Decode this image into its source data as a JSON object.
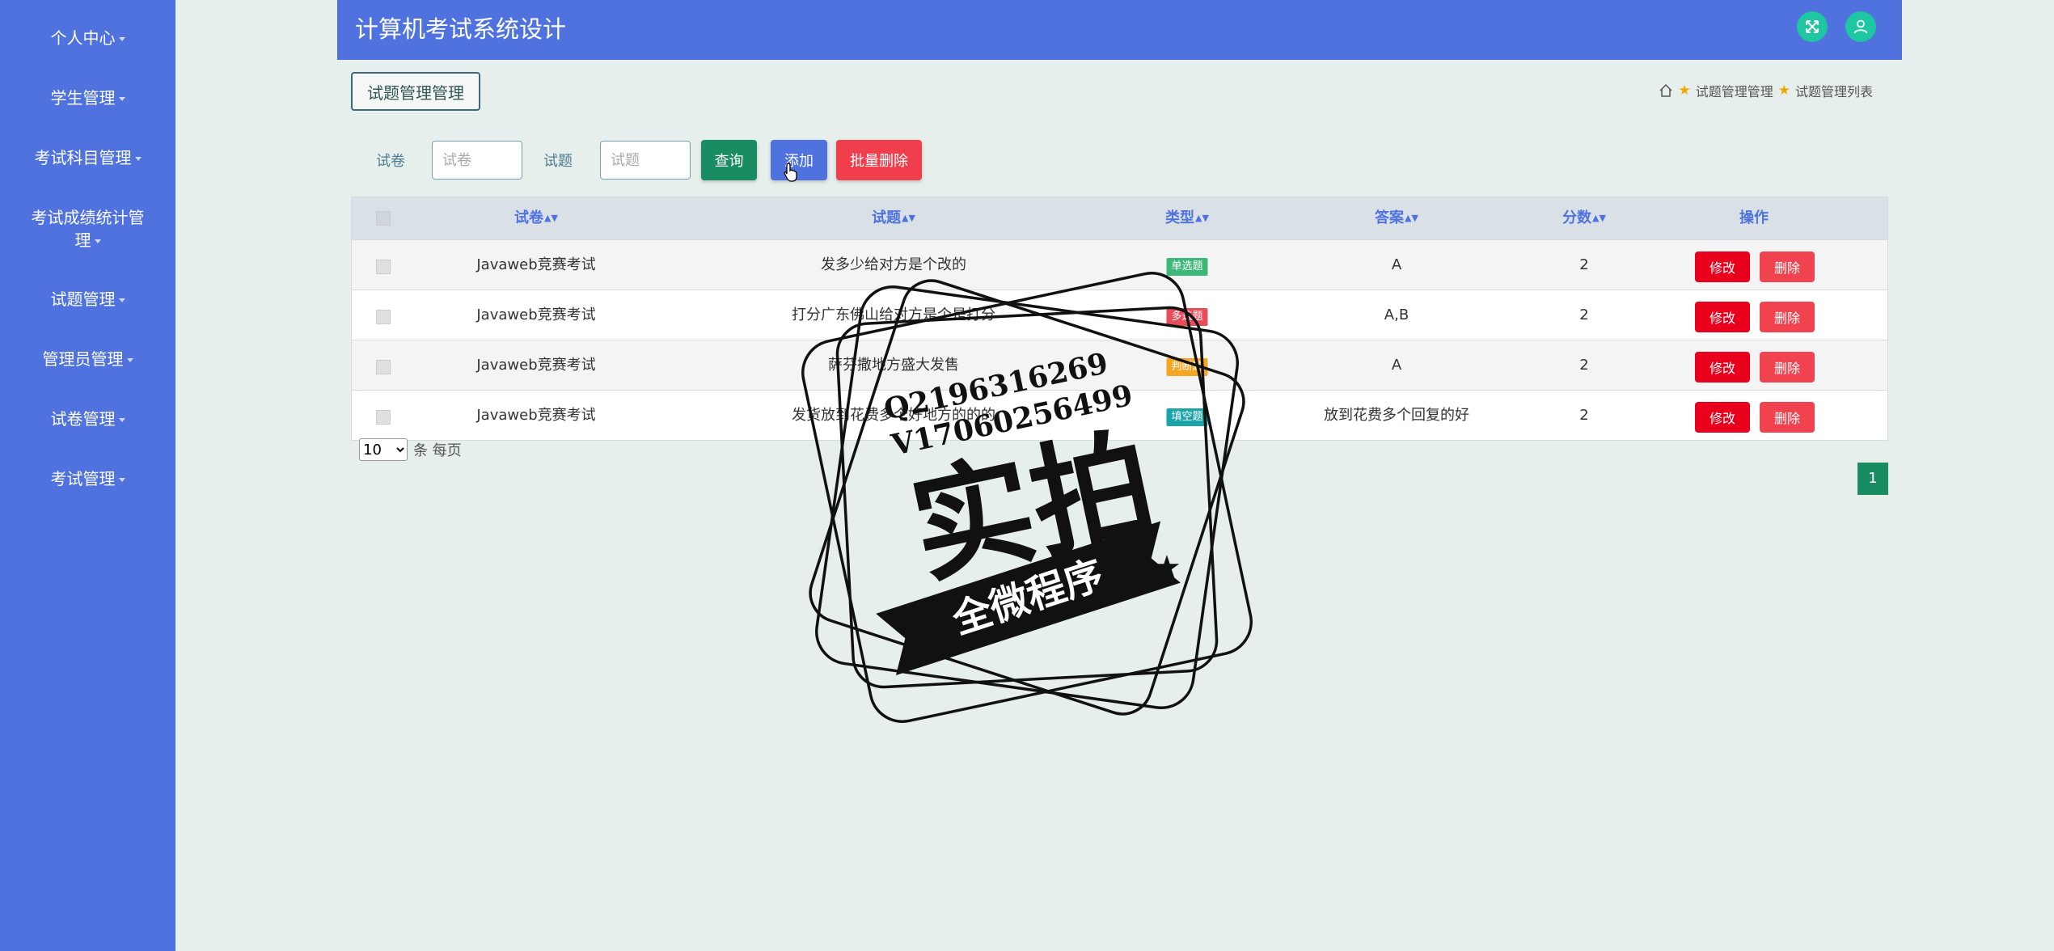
{
  "header": {
    "title": "计算机考试系统设计",
    "icons": [
      "expand-icon",
      "user-icon"
    ],
    "accent_color": "#4f72df"
  },
  "sidebar": {
    "items": [
      {
        "label": "个人中心"
      },
      {
        "label": "学生管理"
      },
      {
        "label": "考试科目管理"
      },
      {
        "label": "考试成绩统计管",
        "label2": "理"
      },
      {
        "label": "试题管理"
      },
      {
        "label": "管理员管理"
      },
      {
        "label": "试卷管理"
      },
      {
        "label": "考试管理"
      }
    ]
  },
  "panel": {
    "title": "试题管理管理",
    "breadcrumb": [
      "试题管理管理",
      "试题管理列表"
    ]
  },
  "search": {
    "paper_label": "试卷",
    "paper_placeholder": "试卷",
    "question_label": "试题",
    "question_placeholder": "试题",
    "query_button": "查询",
    "add_button": "添加",
    "batch_delete_button": "批量删除"
  },
  "table": {
    "headers": {
      "paper": "试卷",
      "question": "试题",
      "type": "类型",
      "answer": "答案",
      "score": "分数",
      "actions": "操作"
    },
    "edit_label": "修改",
    "delete_label": "删除",
    "rows": [
      {
        "paper": "Javaweb竞赛考试",
        "question": "发多少给对方是个改的",
        "type": "单选题",
        "type_color": "#3cb878",
        "answer": "A",
        "score": "2"
      },
      {
        "paper": "Javaweb竞赛考试",
        "question": "打分广东佛山给对方是个是打分",
        "type": "多选题",
        "type_color": "#e74c5a",
        "answer": "A,B",
        "score": "2"
      },
      {
        "paper": "Javaweb竞赛考试",
        "question": "萨芬撒地方盛大发售",
        "type": "判断题",
        "type_color": "#f5a623",
        "answer": "A",
        "score": "2"
      },
      {
        "paper": "Javaweb竞赛考试",
        "question": "发货放到花费多个好地方的的的",
        "type": "填空题",
        "type_color": "#1aa3a8",
        "answer": "放到花费多个回复的好",
        "score": "2"
      }
    ]
  },
  "pagination": {
    "page_size": "10",
    "page_size_suffix": "条 每页",
    "current_page": "1"
  },
  "watermark": {
    "line1": "Q2196316269",
    "line2": "V17060256499",
    "big": "实拍",
    "banner": "全微程序"
  }
}
